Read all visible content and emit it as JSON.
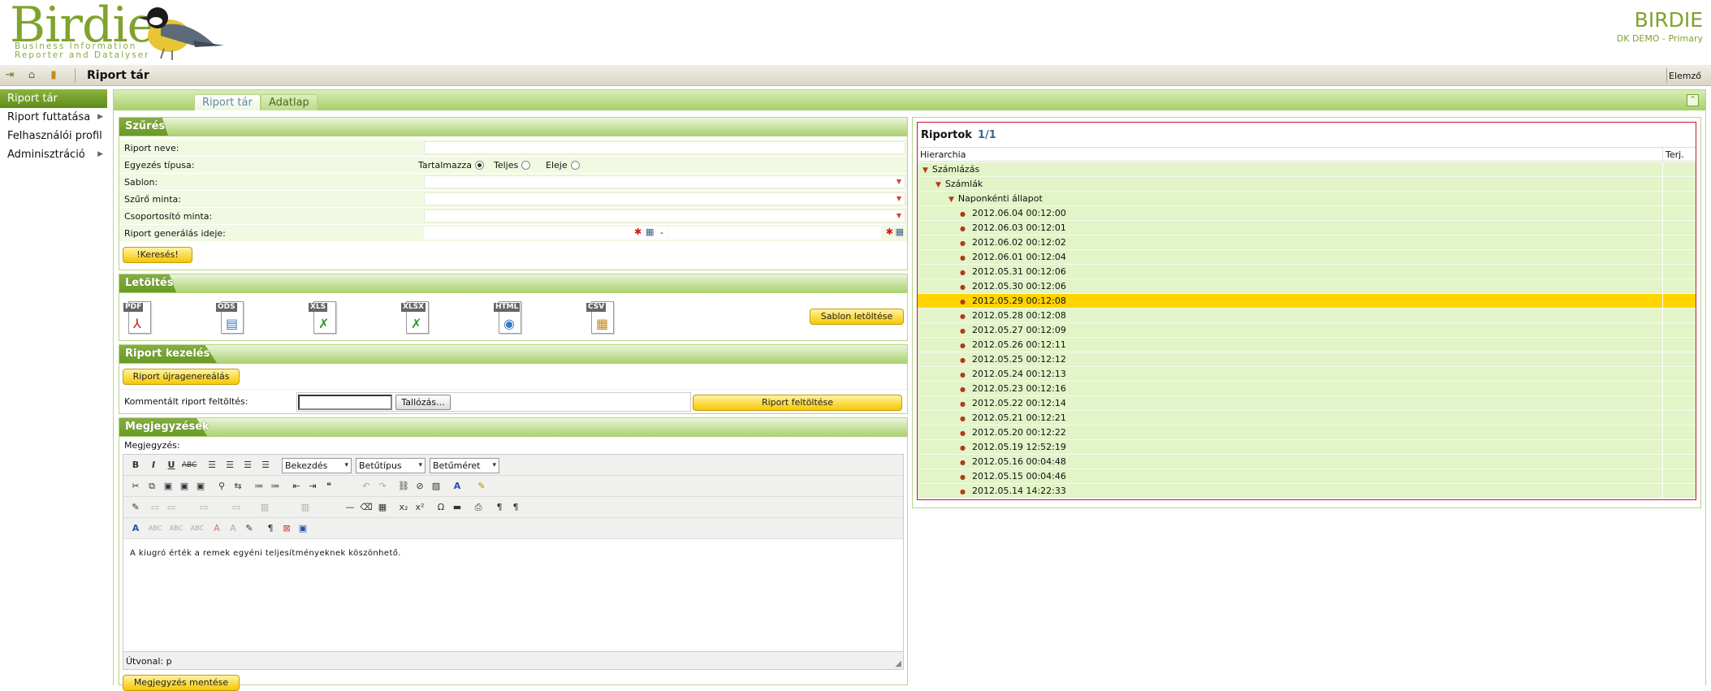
{
  "header": {
    "logo": "Birdie",
    "logo_sub_1": "Business Information",
    "logo_sub_2": "Reporter and Datalyser",
    "brand": "BIRDIE",
    "brand_sub": "DK DEMO - Primary"
  },
  "toolbar": {
    "icons": [
      "export-icon",
      "home-icon",
      "bookmark-icon"
    ],
    "title": "Riport tár",
    "right_label": "Elemző"
  },
  "sidebar": {
    "items": [
      {
        "label": "Riport tár",
        "active": true,
        "submenu": false
      },
      {
        "label": "Riport futtatása",
        "active": false,
        "submenu": true
      },
      {
        "label": "Felhasználói profil",
        "active": false,
        "submenu": false
      },
      {
        "label": "Adminisztráció",
        "active": false,
        "submenu": true
      }
    ]
  },
  "tabs": [
    {
      "label": "Riport tár",
      "active": true
    },
    {
      "label": "Adatlap",
      "active": false
    }
  ],
  "filter": {
    "title": "Szűrés",
    "report_name_label": "Riport neve:",
    "match_type_label": "Egyezés típusa:",
    "match_options": [
      "Tartalmazza",
      "Teljes",
      "Eleje"
    ],
    "match_selected": "Tartalmazza",
    "template_label": "Sablon:",
    "filter_template_label": "Szűrő minta:",
    "grouping_template_label": "Csoportosító minta:",
    "gen_time_label": "Riport generálás ideje:",
    "range_sep": "-",
    "search_button": "!Keresés!"
  },
  "download": {
    "title": "Letöltés",
    "formats": [
      "PDF",
      "ODS",
      "XLS",
      "XLSX",
      "HTML",
      "CSV"
    ],
    "template_button": "Sablon letöltése"
  },
  "manage": {
    "title": "Riport kezelés",
    "regen_button": "Riport újragenereálás",
    "upload_label": "Kommentált riport feltöltés:",
    "browse_button": "Tallózás...",
    "upload_button": "Riport feltöltése"
  },
  "notes": {
    "title": "Megjegyzések",
    "label": "Megjegyzés:",
    "paragraph_select": "Bekezdés",
    "font_select": "Betűtípus",
    "size_select": "Betűméret",
    "body_text": "A kiugró érték a remek egyéni teljesítményeknek köszönhető.",
    "path_label": "Útvonal: p",
    "save_button": "Megjegyzés mentése"
  },
  "reports": {
    "title": "Riportok",
    "count": "1/1",
    "col_hierarchy": "Hierarchia",
    "col_size": "Terj.",
    "tree": [
      {
        "label": "Számlázás",
        "level": 0
      },
      {
        "label": "Számlák",
        "level": 1
      },
      {
        "label": "Naponkénti állapot",
        "level": 2
      }
    ],
    "entries": [
      "2012.06.04 00:12:00",
      "2012.06.03 00:12:01",
      "2012.06.02 00:12:02",
      "2012.06.01 00:12:04",
      "2012.05.31 00:12:06",
      "2012.05.30 00:12:06",
      "2012.05.29 00:12:08",
      "2012.05.28 00:12:08",
      "2012.05.27 00:12:09",
      "2012.05.26 00:12:11",
      "2012.05.25 00:12:12",
      "2012.05.24 00:12:13",
      "2012.05.23 00:12:16",
      "2012.05.22 00:12:14",
      "2012.05.21 00:12:21",
      "2012.05.20 00:12:22",
      "2012.05.19 12:52:19",
      "2012.05.16 00:04:48",
      "2012.05.15 00:04:46",
      "2012.05.14 14:22:33"
    ],
    "selected_entry": "2012.05.29 00:12:08"
  }
}
